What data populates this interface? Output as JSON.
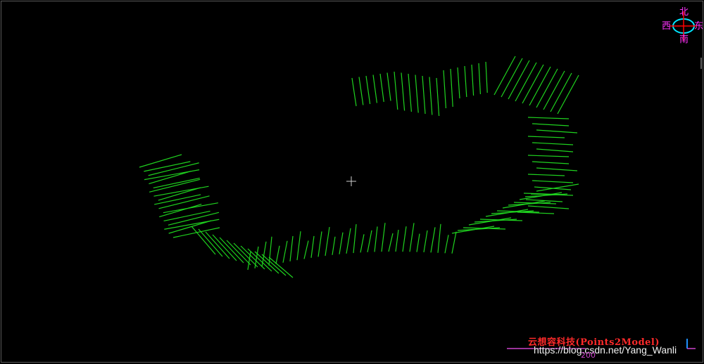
{
  "app": {
    "title": "云想容科技(Points2Model)"
  },
  "viewport": {
    "background": "#000000",
    "line_color": "#1fd21f",
    "accent": "#ff00ff"
  },
  "compass": {
    "north": "北",
    "south": "南",
    "east": "东",
    "west": "西",
    "ring_color": "#00e5ff",
    "cross_color": "#ff0000"
  },
  "brand": {
    "text": "云想容科技(Points2Model)",
    "color": "#ff2a2a"
  },
  "watermark": {
    "text": "https://blog.csdn.net/Yang_Wanli"
  },
  "scale_bar": {
    "label": "200",
    "color": "#cc44cc"
  },
  "icons": {
    "crosshair": "crosshair-icon",
    "compass": "compass-icon",
    "axis_marker": "axis-marker-icon"
  }
}
